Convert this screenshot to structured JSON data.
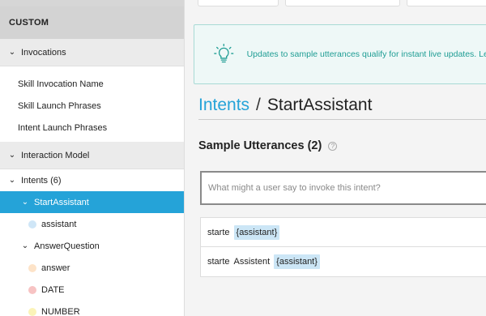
{
  "sidebar": {
    "section_title": "CUSTOM",
    "invocations": {
      "label": "Invocations",
      "items": [
        "Skill Invocation Name",
        "Skill Launch Phrases",
        "Intent Launch Phrases"
      ]
    },
    "interaction_model": {
      "label": "Interaction Model"
    },
    "intents": {
      "label": "Intents (6)",
      "items": [
        {
          "label": "StartAssistant",
          "slots": [
            {
              "label": "assistant",
              "color": "#cfe6f7"
            }
          ]
        },
        {
          "label": "AnswerQuestion",
          "slots": [
            {
              "label": "answer",
              "color": "#fde3c8"
            },
            {
              "label": "DATE",
              "color": "#f7c3c3"
            },
            {
              "label": "NUMBER",
              "color": "#fbf3b8"
            }
          ]
        }
      ]
    }
  },
  "banner": {
    "text": "Updates to sample utterances qualify for instant live updates. Learn"
  },
  "breadcrumb": {
    "root": "Intents",
    "separator": "/",
    "current": "StartAssistant"
  },
  "utterances": {
    "title": "Sample Utterances (2)",
    "help": "?",
    "placeholder": "What might a user say to invoke this intent?",
    "rows": [
      {
        "words": [
          "starte"
        ],
        "slot": "{assistant}"
      },
      {
        "words": [
          "starte",
          "Assistent"
        ],
        "slot": "{assistant}"
      }
    ]
  },
  "colors": {
    "accent": "#25a3d8",
    "banner_text": "#1f9d94",
    "slot_bg": "#cce6f6"
  }
}
